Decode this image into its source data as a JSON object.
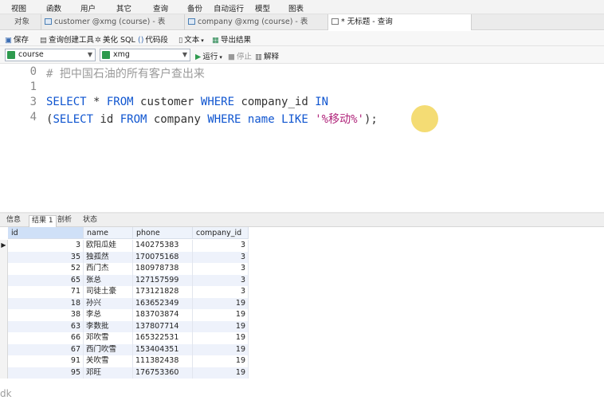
{
  "menu": [
    "视图",
    "函数",
    "用户",
    "其它",
    "查询",
    "备份",
    "自动运行",
    "模型",
    "图表"
  ],
  "tabs": {
    "objects": "对象",
    "customer": "customer @xmg (course) - 表",
    "company": "company @xmg (course) - 表",
    "query": "* 无标题 - 查询"
  },
  "toolbar": {
    "save": "保存",
    "query_builder": "查询创建工具",
    "beautify": "美化 SQL",
    "snippet": "代码段",
    "text": "文本",
    "export": "导出结果"
  },
  "selectors": {
    "database": "course",
    "connection": "xmg",
    "run": "运行",
    "stop": "停止",
    "explain": "解释"
  },
  "editor": {
    "line_numbers": [
      "0",
      "1",
      "3",
      "4"
    ],
    "line0_comment": "# 把中国石油的所有客户查出来",
    "line3": {
      "k1": "SELECT",
      "t1": " * ",
      "k2": "FROM",
      "t2": " customer ",
      "k3": "WHERE",
      "t3": " company_id ",
      "k4": "IN"
    },
    "line4": {
      "t0": "(",
      "k1": "SELECT",
      "t1": " id ",
      "k2": "FROM",
      "t2": " company ",
      "k3": "WHERE",
      "t3": " ",
      "k4": "name",
      "t4": " ",
      "k5": "LIKE",
      "t5": " ",
      "s1": "'%移动%'",
      "t6": ");"
    }
  },
  "result_tabs": [
    "信息",
    "结果 1",
    "剖析",
    "状态"
  ],
  "columns": [
    "id",
    "name",
    "phone",
    "company_id"
  ],
  "rows": [
    {
      "id": "3",
      "name": "欧阳瓜娃",
      "phone": "140275383",
      "company_id": "3"
    },
    {
      "id": "35",
      "name": "独孤然",
      "phone": "170075168",
      "company_id": "3"
    },
    {
      "id": "52",
      "name": "西门杰",
      "phone": "180978738",
      "company_id": "3"
    },
    {
      "id": "65",
      "name": "张总",
      "phone": "127157599",
      "company_id": "3"
    },
    {
      "id": "71",
      "name": "司徒土豪",
      "phone": "173121828",
      "company_id": "3"
    },
    {
      "id": "18",
      "name": "孙兴",
      "phone": "163652349",
      "company_id": "19"
    },
    {
      "id": "38",
      "name": "李总",
      "phone": "183703874",
      "company_id": "19"
    },
    {
      "id": "63",
      "name": "李数批",
      "phone": "137807714",
      "company_id": "19"
    },
    {
      "id": "66",
      "name": "邓吹雪",
      "phone": "165322531",
      "company_id": "19"
    },
    {
      "id": "67",
      "name": "西门吹雪",
      "phone": "153404351",
      "company_id": "19"
    },
    {
      "id": "91",
      "name": "关吹雪",
      "phone": "111382438",
      "company_id": "19"
    },
    {
      "id": "95",
      "name": "邓旺",
      "phone": "176753360",
      "company_id": "19"
    }
  ],
  "watermark": "dk"
}
